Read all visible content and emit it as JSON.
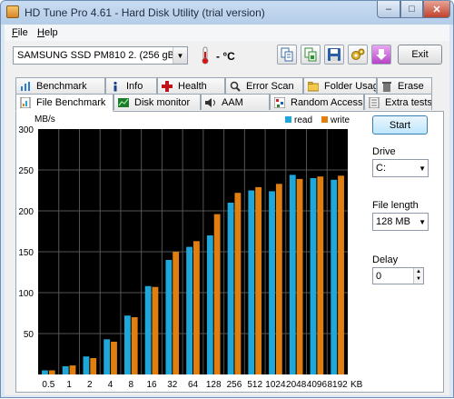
{
  "window": {
    "title": "HD Tune Pro 4.61 - Hard Disk Utility (trial version)",
    "min_glyph": "–",
    "max_glyph": "□",
    "close_glyph": "✕"
  },
  "menu": {
    "file_u": "F",
    "file_rest": "ile",
    "help_u": "H",
    "help_rest": "elp"
  },
  "toolbar": {
    "drive": "SAMSUNG SSD PM810 2.     (256 gB)",
    "temperature": "- °C",
    "exit_label": "Exit",
    "buttons": [
      "copy-text-icon",
      "copy-screenshot-icon",
      "save-icon",
      "options-icon",
      "download-icon"
    ]
  },
  "tabs_row1": [
    {
      "label": "Benchmark",
      "icon": "benchmark-icon"
    },
    {
      "label": "Info",
      "icon": "info-icon"
    },
    {
      "label": "Health",
      "icon": "health-icon"
    },
    {
      "label": "Error Scan",
      "icon": "error-scan-icon"
    },
    {
      "label": "Folder Usage",
      "icon": "folder-icon"
    },
    {
      "label": "Erase",
      "icon": "erase-icon"
    }
  ],
  "tabs_row2": [
    {
      "label": "File Benchmark",
      "icon": "file-benchmark-icon",
      "active": true
    },
    {
      "label": "Disk monitor",
      "icon": "disk-monitor-icon"
    },
    {
      "label": "AAM",
      "icon": "speaker-icon"
    },
    {
      "label": "Random Access",
      "icon": "random-access-icon"
    },
    {
      "label": "Extra tests",
      "icon": "extra-tests-icon"
    }
  ],
  "side": {
    "start_label": "Start",
    "drive_label": "Drive",
    "drive_value": "C:",
    "file_length_label": "File length",
    "file_length_value": "128 MB",
    "delay_label": "Delay",
    "delay_value": "0"
  },
  "chart_data": {
    "type": "bar",
    "ylabel": "MB/s",
    "xlabel_unit": "KB",
    "ylim": [
      0,
      300
    ],
    "yticks": [
      "50",
      "100",
      "150",
      "200",
      "250",
      "300"
    ],
    "categories": [
      "0.5",
      "1",
      "2",
      "4",
      "8",
      "16",
      "32",
      "64",
      "128",
      "256",
      "512",
      "1024",
      "2048",
      "4096",
      "8192"
    ],
    "series": [
      {
        "name": "read",
        "color": "#1ea7d8",
        "values": [
          5,
          10,
          22,
          43,
          72,
          108,
          140,
          156,
          170,
          210,
          225,
          224,
          244,
          240,
          238
        ]
      },
      {
        "name": "write",
        "color": "#e07f10",
        "values": [
          5,
          11,
          20,
          40,
          70,
          107,
          150,
          163,
          196,
          222,
          229,
          233,
          239,
          242,
          243
        ]
      }
    ],
    "grid": true,
    "legend": "top-right",
    "background": "#000000"
  }
}
